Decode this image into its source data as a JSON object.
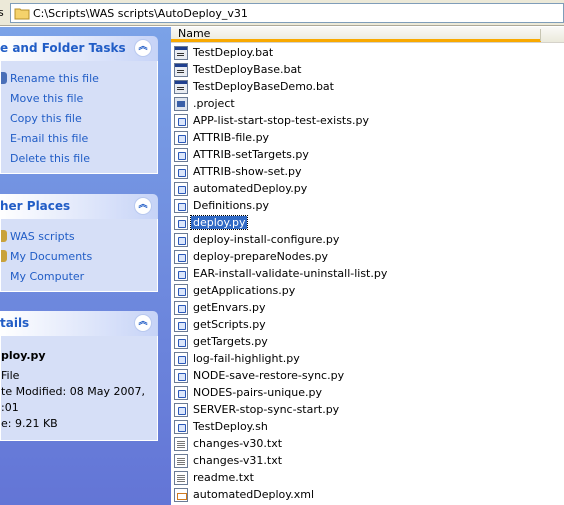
{
  "address": {
    "label": "s",
    "path": "C:\\Scripts\\WAS scripts\\AutoDeploy_v31"
  },
  "task_pane": {
    "file_tasks": {
      "title": "e and Folder Tasks",
      "items": [
        {
          "label": "Rename this file",
          "icon": "rename-icon"
        },
        {
          "label": "Move this file",
          "icon": "move-icon"
        },
        {
          "label": "Copy this file",
          "icon": "copy-icon"
        },
        {
          "label": "E-mail this file",
          "icon": "email-icon"
        },
        {
          "label": "Delete this file",
          "icon": "delete-icon"
        }
      ]
    },
    "other_places": {
      "title": "her Places",
      "items": [
        {
          "label": "WAS scripts",
          "icon": "folder-icon"
        },
        {
          "label": "My Documents",
          "icon": "my-documents-icon"
        },
        {
          "label": "My Computer",
          "icon": "my-computer-icon"
        }
      ]
    },
    "details": {
      "title": "tails",
      "name": "ploy.py",
      "type": " File",
      "modified_line1": "te Modified: 08 May 2007,",
      "modified_line2": ":01",
      "size": "e: 9.21 KB"
    }
  },
  "list": {
    "column_name": "Name",
    "selected_index": 10,
    "files": [
      {
        "name": "TestDeploy.bat",
        "type": "bat"
      },
      {
        "name": "TestDeployBase.bat",
        "type": "bat"
      },
      {
        "name": "TestDeployBaseDemo.bat",
        "type": "bat"
      },
      {
        "name": ".project",
        "type": "project"
      },
      {
        "name": "APP-list-start-stop-test-exists.py",
        "type": "py"
      },
      {
        "name": "ATTRIB-file.py",
        "type": "py"
      },
      {
        "name": "ATTRIB-setTargets.py",
        "type": "py"
      },
      {
        "name": "ATTRIB-show-set.py",
        "type": "py"
      },
      {
        "name": "automatedDeploy.py",
        "type": "py"
      },
      {
        "name": "Definitions.py",
        "type": "py"
      },
      {
        "name": "deploy.py",
        "type": "py"
      },
      {
        "name": "deploy-install-configure.py",
        "type": "py"
      },
      {
        "name": "deploy-prepareNodes.py",
        "type": "py"
      },
      {
        "name": "EAR-install-validate-uninstall-list.py",
        "type": "py"
      },
      {
        "name": "getApplications.py",
        "type": "py"
      },
      {
        "name": "getEnvars.py",
        "type": "py"
      },
      {
        "name": "getScripts.py",
        "type": "py"
      },
      {
        "name": "getTargets.py",
        "type": "py"
      },
      {
        "name": "log-fail-highlight.py",
        "type": "py"
      },
      {
        "name": "NODE-save-restore-sync.py",
        "type": "py"
      },
      {
        "name": "NODES-pairs-unique.py",
        "type": "py"
      },
      {
        "name": "SERVER-stop-sync-start.py",
        "type": "py"
      },
      {
        "name": "TestDeploy.sh",
        "type": "py"
      },
      {
        "name": "changes-v30.txt",
        "type": "txt"
      },
      {
        "name": "changes-v31.txt",
        "type": "txt"
      },
      {
        "name": "readme.txt",
        "type": "txt"
      },
      {
        "name": "automatedDeploy.xml",
        "type": "xml"
      }
    ]
  },
  "colors": {
    "task_link": "#215dc6",
    "selection": "#316ac5",
    "pane_gradient_top": "#7ba2e7",
    "pane_gradient_bottom": "#6375d6"
  }
}
